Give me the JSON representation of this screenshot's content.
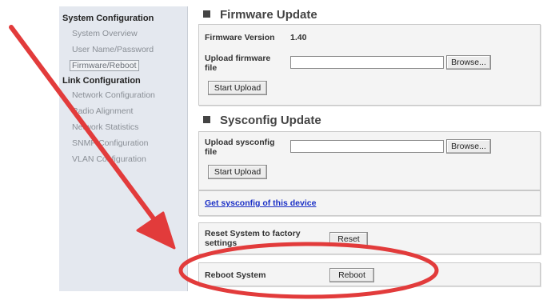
{
  "sidebar": {
    "system_heading": "System Configuration",
    "system_items": [
      "System Overview",
      "User Name/Password",
      "Firmware/Reboot"
    ],
    "link_heading": "Link Configuration",
    "link_items": [
      "Network Configuration",
      "Radio Alignment",
      "Network Statistics",
      "SNMP Configuration",
      "VLAN Configuration"
    ],
    "active_item": "Firmware/Reboot"
  },
  "firmware": {
    "title": "Firmware Update",
    "version_label": "Firmware Version",
    "version_value": "1.40",
    "upload_label": "Upload firmware file",
    "browse_label": "Browse...",
    "start_label": "Start Upload"
  },
  "sysconfig": {
    "title": "Sysconfig Update",
    "upload_label": "Upload sysconfig file",
    "browse_label": "Browse...",
    "start_label": "Start Upload",
    "get_link": "Get sysconfig of this device"
  },
  "reset": {
    "label": "Reset System to factory settings",
    "button": "Reset"
  },
  "reboot": {
    "label": "Reboot System",
    "button": "Reboot"
  },
  "annotation": {
    "color": "#e23b3b"
  }
}
